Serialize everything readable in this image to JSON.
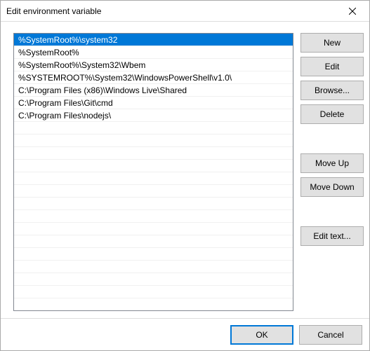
{
  "window": {
    "title": "Edit environment variable"
  },
  "list": {
    "items": [
      "%SystemRoot%\\system32",
      "%SystemRoot%",
      "%SystemRoot%\\System32\\Wbem",
      "%SYSTEMROOT%\\System32\\WindowsPowerShell\\v1.0\\",
      "C:\\Program Files (x86)\\Windows Live\\Shared",
      "C:\\Program Files\\Git\\cmd",
      "C:\\Program Files\\nodejs\\"
    ],
    "selected_index": 0
  },
  "buttons": {
    "new": "New",
    "edit": "Edit",
    "browse": "Browse...",
    "delete": "Delete",
    "move_up": "Move Up",
    "move_down": "Move Down",
    "edit_text": "Edit text...",
    "ok": "OK",
    "cancel": "Cancel"
  }
}
